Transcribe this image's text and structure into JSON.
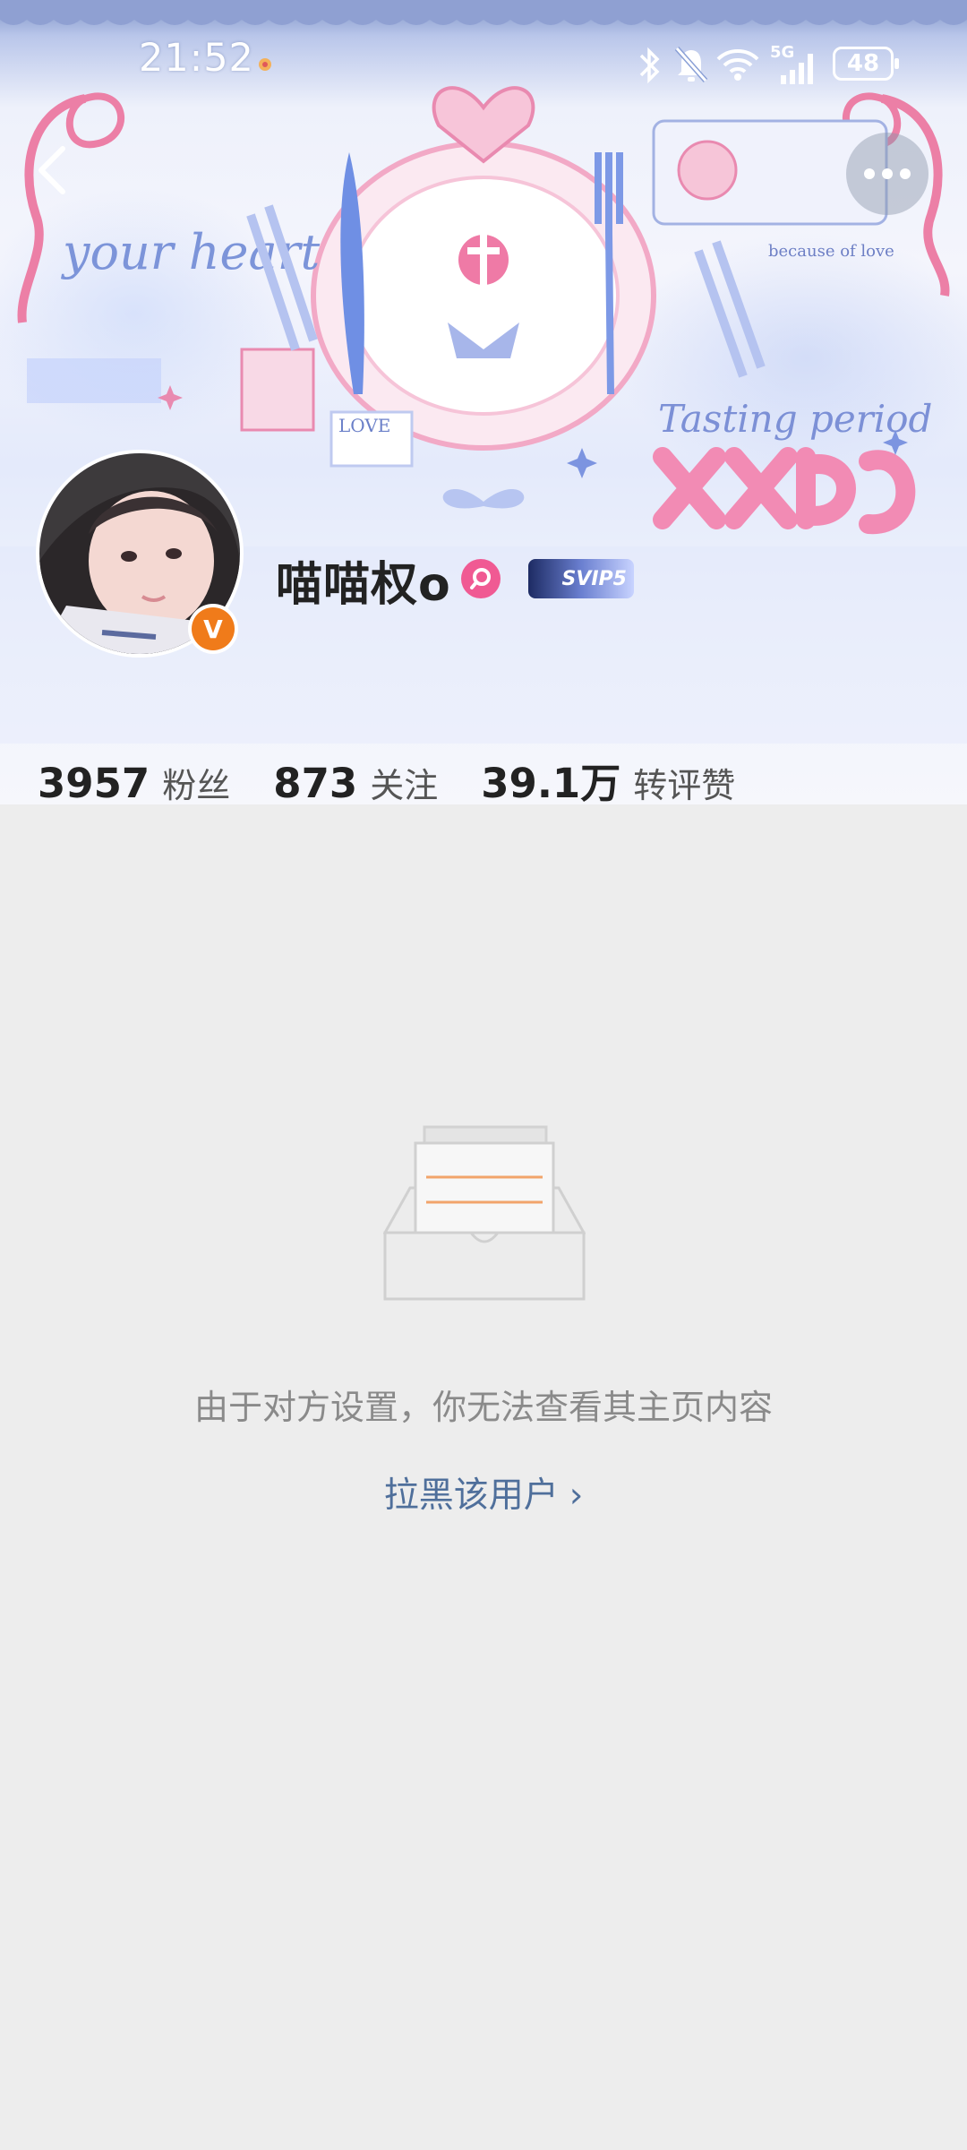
{
  "status_bar": {
    "time": "21:52",
    "battery": "48",
    "network": "5G"
  },
  "header": {
    "back_icon": "chevron-left-icon",
    "more_icon": "more-dots-icon",
    "banner_texts": {
      "your_heart": "your heart",
      "tasting_period": "Tasting period",
      "because_of_love": "because of love",
      "love_stamp": "LOVE"
    }
  },
  "profile": {
    "username": "喵喵权o",
    "verify_badge": "V",
    "vip_badge": "SVIP5"
  },
  "stats": [
    {
      "value": "3957",
      "label": "粉丝"
    },
    {
      "value": "873",
      "label": "关注"
    },
    {
      "value": "39.1万",
      "label": "转评赞"
    }
  ],
  "empty_state": {
    "message": "由于对方设置，你无法查看其主页内容",
    "action": "拉黑该用户",
    "action_chevron": "›"
  },
  "colors": {
    "background": "#ededed",
    "link": "#4f6f9b",
    "verify_orange": "#f07b1a",
    "pink": "#f05a93"
  }
}
